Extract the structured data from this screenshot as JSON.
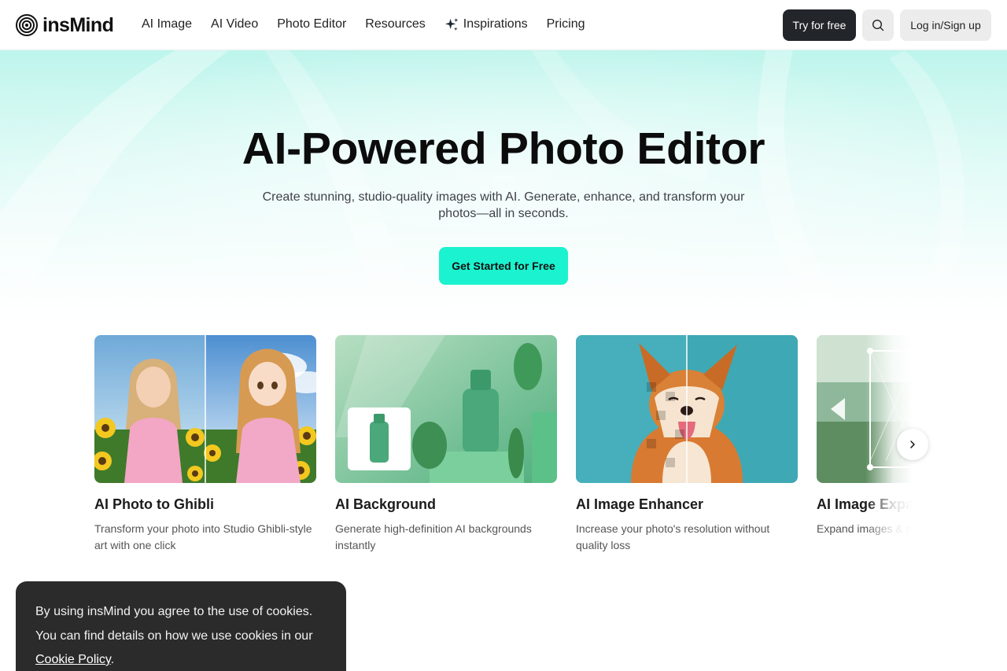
{
  "brand": {
    "name": "insMind"
  },
  "nav": {
    "items": [
      {
        "label": "AI Image"
      },
      {
        "label": "AI Video"
      },
      {
        "label": "Photo Editor"
      },
      {
        "label": "Resources"
      },
      {
        "label": "Inspirations",
        "icon": "sparkle-icon"
      },
      {
        "label": "Pricing"
      }
    ],
    "try_label": "Try for free",
    "search_icon": "search-icon",
    "login_label": "Log in/Sign up"
  },
  "hero": {
    "title": "AI-Powered Photo Editor",
    "subtitle": "Create stunning, studio-quality images with AI. Generate, enhance, and transform your photos—all in seconds.",
    "cta_label": "Get Started for Free"
  },
  "cards": [
    {
      "title": "AI Photo to Ghibli",
      "description": "Transform your photo into Studio Ghibli-style art with one click"
    },
    {
      "title": "AI Background",
      "description": "Generate high-definition AI backgrounds instantly"
    },
    {
      "title": "AI Image Enhancer",
      "description": "Increase your photo's resolution without quality loss"
    },
    {
      "title": "AI Image Expander",
      "description": "Expand images & photos with AI outpainting"
    }
  ],
  "carousel": {
    "next_icon": "chevron-right-icon"
  },
  "cookie": {
    "text": "By using insMind you agree to the use of cookies. You can find details on how we use cookies in our ",
    "link_label": "Cookie Policy",
    "suffix": "."
  },
  "colors": {
    "accent": "#1bf2cf",
    "dark_button": "#22252a",
    "light_button": "#ececec",
    "cookie_bg": "#2b2b2b"
  }
}
